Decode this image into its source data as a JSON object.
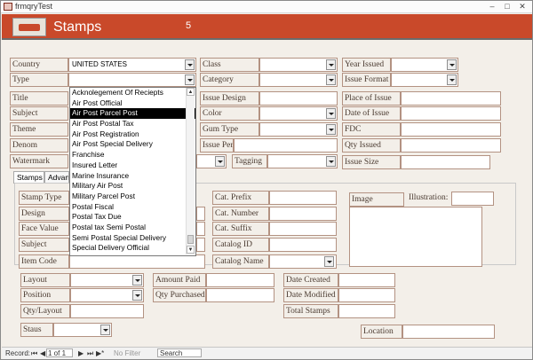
{
  "window": {
    "title": "frmqryTest"
  },
  "header": {
    "title": "Stamps",
    "number": "5"
  },
  "fields": {
    "country": {
      "label": "Country",
      "value": "UNITED STATES"
    },
    "type": {
      "label": "Type",
      "value": ""
    },
    "title": {
      "label": "Title"
    },
    "subject": {
      "label": "Subject"
    },
    "theme": {
      "label": "Theme"
    },
    "denom": {
      "label": "Denom"
    },
    "watermark": {
      "label": "Watermark"
    },
    "class": {
      "label": "Class"
    },
    "category": {
      "label": "Category"
    },
    "issue_design": {
      "label": "Issue Design"
    },
    "color": {
      "label": "Color"
    },
    "gum_type": {
      "label": "Gum Type"
    },
    "issue_perf": {
      "label": "Issue Perf"
    },
    "tagging": {
      "label": "Tagging"
    },
    "year_issued": {
      "label": "Year Issued"
    },
    "issue_format": {
      "label": "Issue Format"
    },
    "place_of_issue": {
      "label": "Place of Issue"
    },
    "date_of_issue": {
      "label": "Date of Issue"
    },
    "fdc": {
      "label": "FDC"
    },
    "qty_issued": {
      "label": "Qty Issued"
    },
    "issue_size": {
      "label": "Issue Size"
    }
  },
  "tabs": [
    {
      "label": "Stamps"
    },
    {
      "label": "Advanc"
    }
  ],
  "tab_fields": {
    "stamp_type": "Stamp Type",
    "design": "Design",
    "face_value": "Face Value",
    "subject": "Subject",
    "item_code": "Item Code",
    "cat_prefix": "Cat. Prefix",
    "cat_number": "Cat. Number",
    "cat_suffix": "Cat. Suffix",
    "catalog_id": "Catalog ID",
    "catalog_name": "Catalog Name",
    "image": "Image",
    "illustration": "Illustration:"
  },
  "bottom": {
    "layout": "Layout",
    "position": "Position",
    "qty_layout": "Qty/Layout",
    "staus": "Staus",
    "amount_paid": "Amount Paid",
    "qty_purchased": "Qty Purchased",
    "date_created": "Date Created",
    "date_modified": "Date Modified",
    "total_stamps": "Total Stamps",
    "location": "Location"
  },
  "dropdown_list": {
    "items": [
      {
        "label": "Acknolegement Of Reciepts",
        "selected": false
      },
      {
        "label": "Air Post Official",
        "selected": false
      },
      {
        "label": "Air Post Parcel Post",
        "selected": true
      },
      {
        "label": "Air Post Postal Tax",
        "selected": false
      },
      {
        "label": "Air Post Registration",
        "selected": false
      },
      {
        "label": "Air Post Special Delivery",
        "selected": false
      },
      {
        "label": "Franchise",
        "selected": false
      },
      {
        "label": "Insured Letter",
        "selected": false
      },
      {
        "label": "Marine Insurance",
        "selected": false
      },
      {
        "label": "Military Air Post",
        "selected": false
      },
      {
        "label": "Military Parcel Post",
        "selected": false
      },
      {
        "label": "Postal Fiscal",
        "selected": false
      },
      {
        "label": "Postal Tax Due",
        "selected": false
      },
      {
        "label": "Postal tax Semi Postal",
        "selected": false
      },
      {
        "label": "Semi Postal Special Delivery",
        "selected": false
      },
      {
        "label": "Special Delivery Official",
        "selected": false
      }
    ]
  },
  "status_bar": {
    "record_label": "Record:",
    "record_value": "1 of 1",
    "no_filter": "No Filter",
    "search": "Search"
  },
  "colors": {
    "header": "#c9492a",
    "selection": "#000000",
    "label_border": "#b39282"
  }
}
